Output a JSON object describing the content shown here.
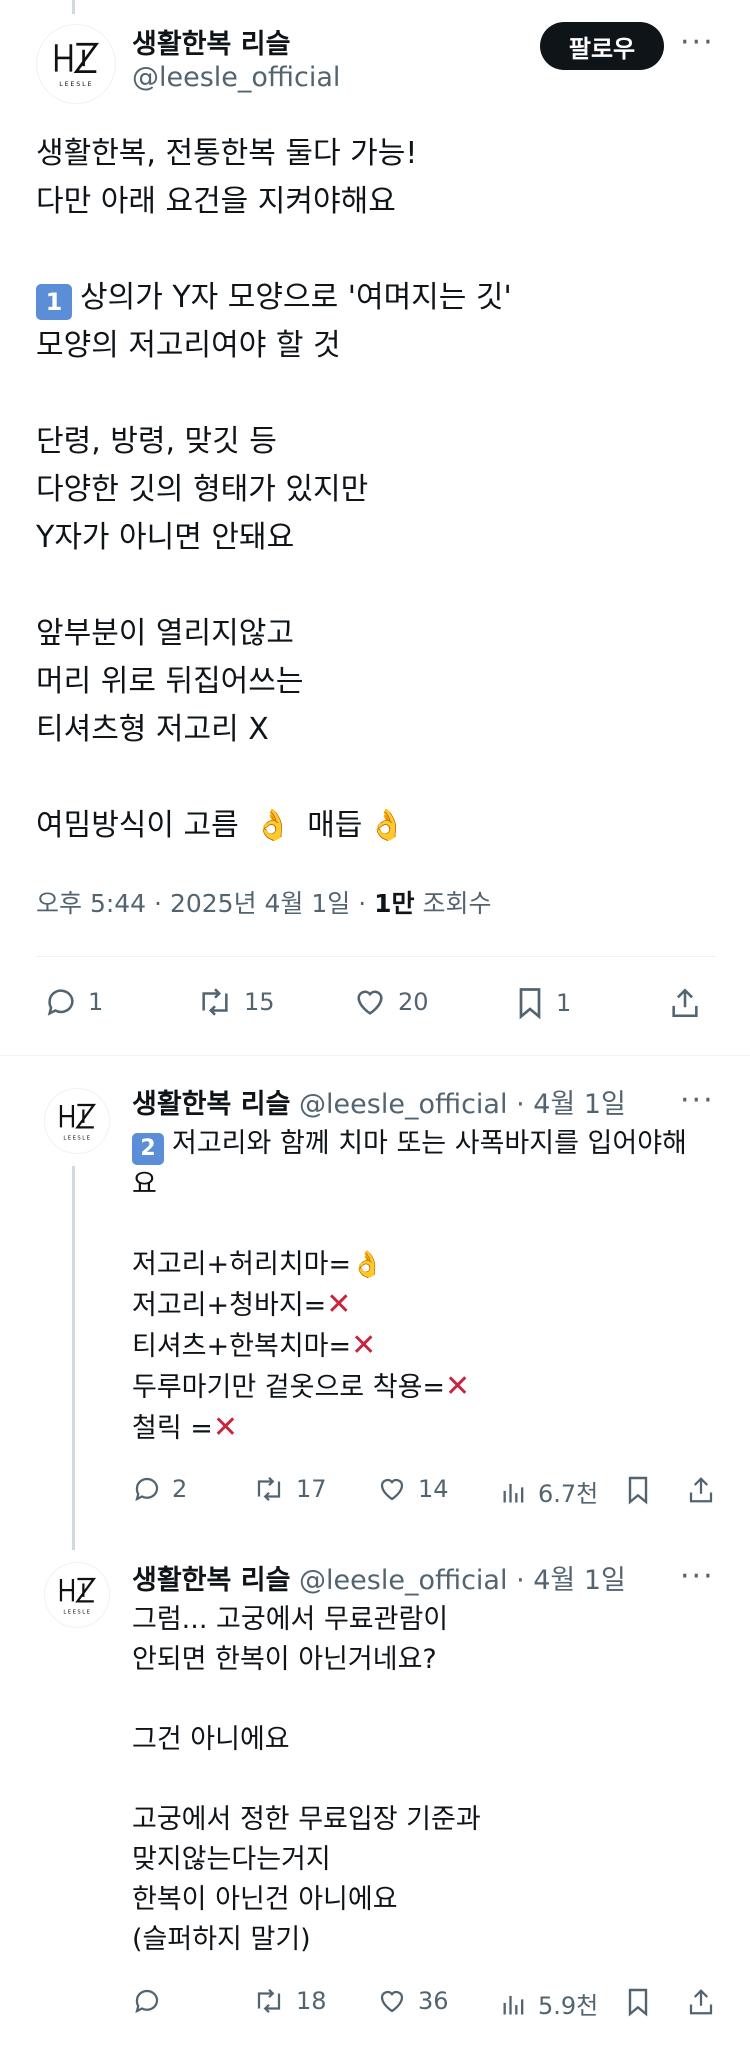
{
  "main_tweet": {
    "author_name": "생활한복 리슬",
    "author_handle": "@leesle_official",
    "avatar_logo": "LEESLE",
    "follow_label": "팔로우",
    "more_label": "···",
    "lines": [
      "생활한복, 전통한복 둘다 가능!",
      "다만 아래 요건을 지켜야해요",
      "",
      "상의가 Y자 모양으로 '여며지는 깃'",
      "모양의 저고리여야 할 것",
      "",
      "단령, 방령, 맞깃 등",
      "다양한 깃의 형태가 있지만",
      "Y자가 아니면 안돼요",
      "",
      "앞부분이 열리지않고",
      "머리 위로 뒤집어쓰는",
      "티셔츠형 저고리 X",
      "",
      "여밈방식이 고름",
      "매듭"
    ],
    "badge_1": "1",
    "ok_emoji": "👌",
    "meta": {
      "time": "오후 5:44",
      "dot": "·",
      "date": "2025년 4월 1일",
      "views_count": "1만",
      "views_label": "조회수"
    },
    "stats": {
      "replies": "1",
      "reposts": "15",
      "likes": "20",
      "bookmarks": "1"
    }
  },
  "replies": [
    {
      "author_name": "생활한복 리슬",
      "author_handle": "@leesle_official",
      "date": "4월 1일",
      "badge": "2",
      "lines": [
        "저고리와 함께 치마 또는 사폭바지를 입어야해",
        "요",
        "",
        "저고리+허리치마=",
        "저고리+청바지=",
        "티셔츠+한복치마=",
        "두루마기만 겉옷으로 착용=",
        "철릭 ="
      ],
      "x_mark": "✕",
      "stats": {
        "replies": "2",
        "reposts": "17",
        "likes": "14",
        "views": "6.7천"
      }
    },
    {
      "author_name": "생활한복 리슬",
      "author_handle": "@leesle_official",
      "date": "4월 1일",
      "lines": [
        "그럼... 고궁에서 무료관람이",
        "안되면 한복이 아닌거네요?",
        "",
        "그건 아니에요",
        "",
        "고궁에서 정한 무료입장 기준과",
        "맞지않는다는거지",
        "한복이 아닌건 아니에요",
        "(슬퍼하지 말기)"
      ],
      "stats": {
        "replies": "",
        "reposts": "18",
        "likes": "36",
        "views": "5.9천"
      }
    }
  ],
  "colors": {
    "text": "#0f1419",
    "secondary": "#536471",
    "badge": "#5b8ed6",
    "x_mark": "#c7253e",
    "divider": "#eff3f4"
  }
}
